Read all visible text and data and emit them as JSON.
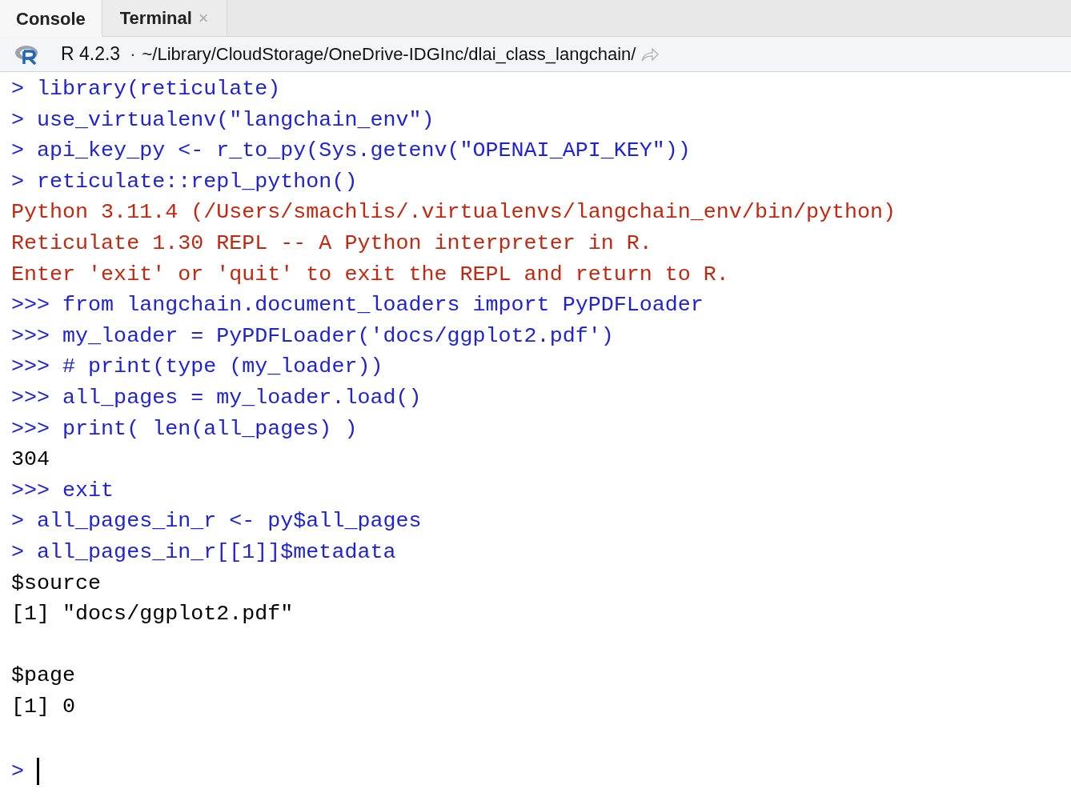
{
  "tabs": [
    {
      "label": "Console",
      "selected": true
    },
    {
      "label": "Terminal",
      "selected": false,
      "close": "×"
    }
  ],
  "path_bar": {
    "version": "R 4.2.3",
    "separator": "·",
    "path": "~/Library/CloudStorage/OneDrive-IDGInc/dlai_class_langchain/"
  },
  "console_lines": [
    {
      "kind": "input",
      "prompt": ">",
      "code": "library(reticulate)"
    },
    {
      "kind": "input",
      "prompt": ">",
      "code": "use_virtualenv(\"langchain_env\")"
    },
    {
      "kind": "input",
      "prompt": ">",
      "code": "api_key_py <- r_to_py(Sys.getenv(\"OPENAI_API_KEY\"))"
    },
    {
      "kind": "input",
      "prompt": ">",
      "code": "reticulate::repl_python()"
    },
    {
      "kind": "message",
      "text": "Python 3.11.4 (/Users/smachlis/.virtualenvs/langchain_env/bin/python)"
    },
    {
      "kind": "message",
      "text": "Reticulate 1.30 REPL -- A Python interpreter in R."
    },
    {
      "kind": "message",
      "text": "Enter 'exit' or 'quit' to exit the REPL and return to R."
    },
    {
      "kind": "input",
      "prompt": ">>>",
      "code": "from langchain.document_loaders import PyPDFLoader"
    },
    {
      "kind": "input",
      "prompt": ">>>",
      "code": "my_loader = PyPDFLoader('docs/ggplot2.pdf')"
    },
    {
      "kind": "input",
      "prompt": ">>>",
      "code": "# print(type (my_loader))"
    },
    {
      "kind": "input",
      "prompt": ">>>",
      "code": "all_pages = my_loader.load()"
    },
    {
      "kind": "input",
      "prompt": ">>>",
      "code": "print( len(all_pages) )"
    },
    {
      "kind": "output",
      "text": "304"
    },
    {
      "kind": "input",
      "prompt": ">>>",
      "code": "exit"
    },
    {
      "kind": "input",
      "prompt": ">",
      "code": "all_pages_in_r <- py$all_pages"
    },
    {
      "kind": "input",
      "prompt": ">",
      "code": "all_pages_in_r[[1]]$metadata"
    },
    {
      "kind": "output",
      "text": "$source"
    },
    {
      "kind": "output",
      "text": "[1] \"docs/ggplot2.pdf\""
    },
    {
      "kind": "blank"
    },
    {
      "kind": "output",
      "text": "$page"
    },
    {
      "kind": "output",
      "text": "[1] 0"
    },
    {
      "kind": "blank"
    },
    {
      "kind": "cursor",
      "prompt": ">"
    }
  ]
}
